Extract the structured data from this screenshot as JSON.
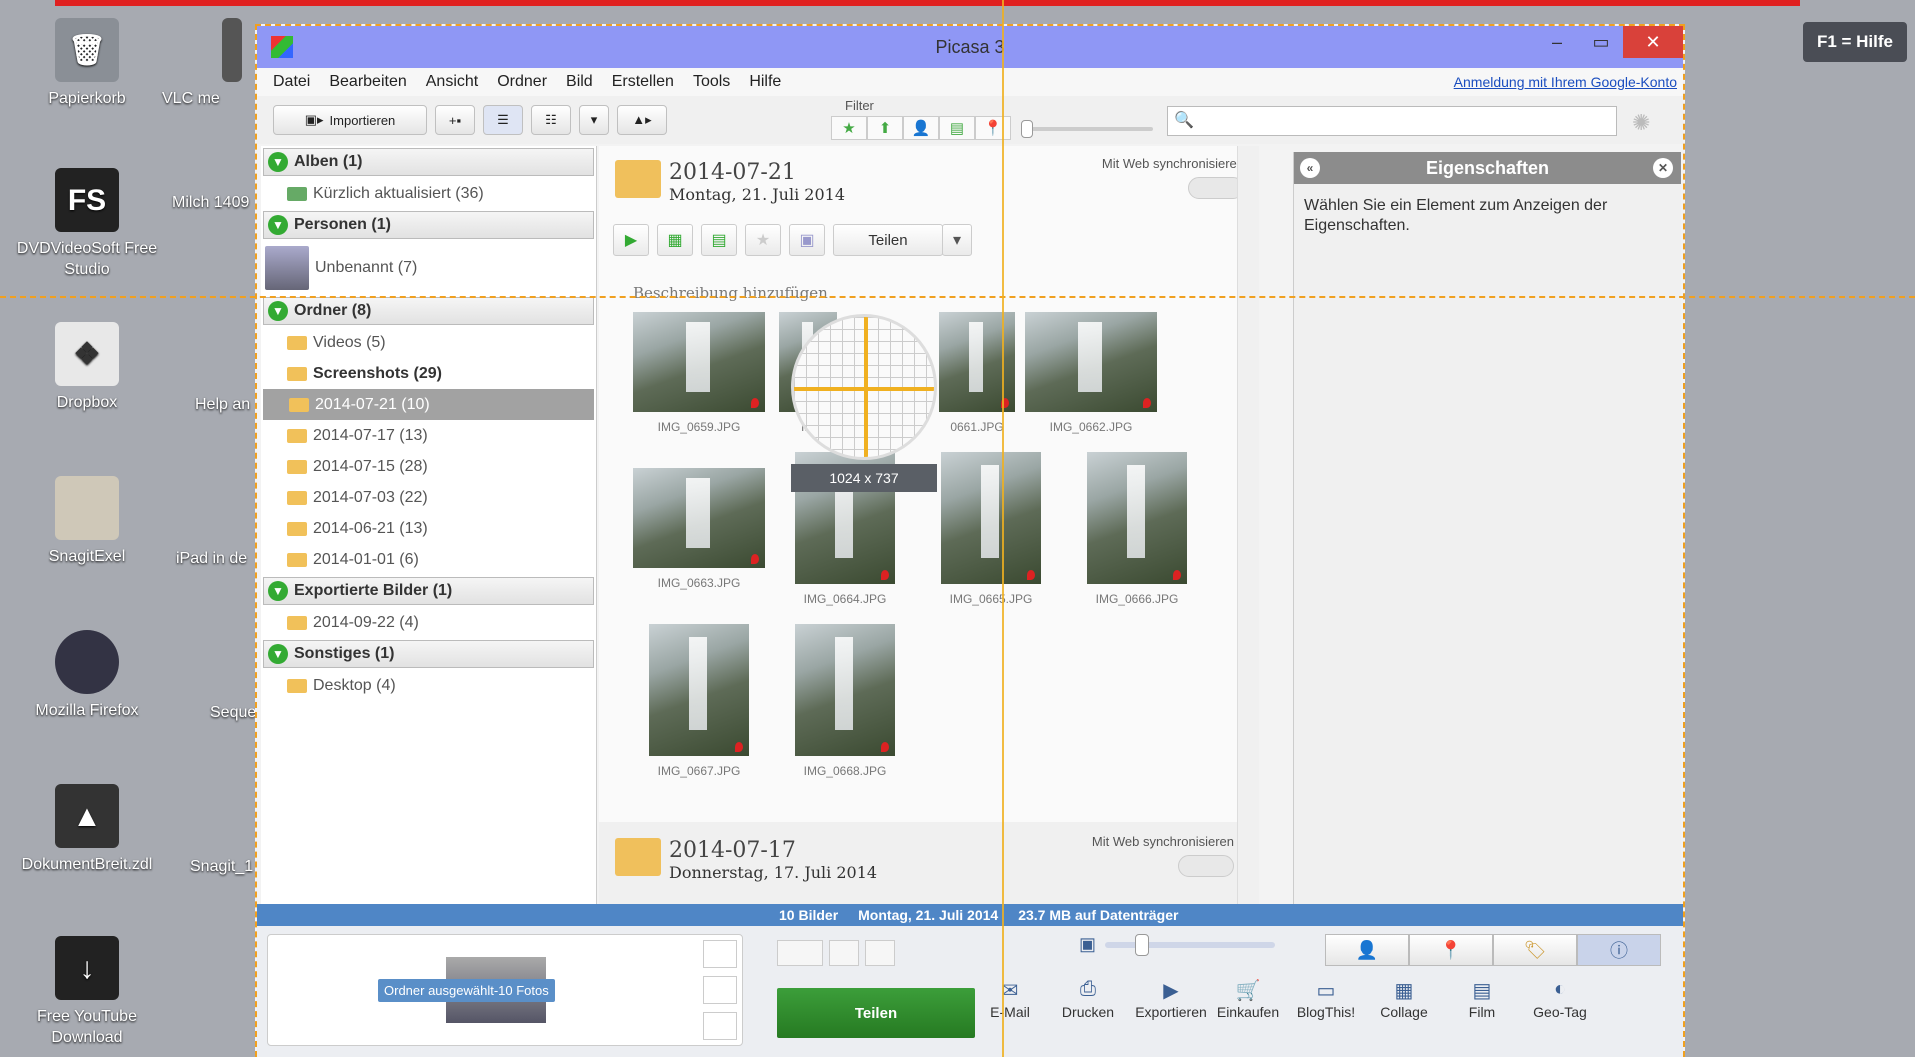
{
  "help": "F1 = Hilfe",
  "desktop": [
    {
      "label": "Papierkorb"
    },
    {
      "label": "VLC me"
    },
    {
      "label": "DVDVideoSoft Free Studio"
    },
    {
      "label": "Milch 1409"
    },
    {
      "label": "Dropbox"
    },
    {
      "label": "Help an"
    },
    {
      "label": "SnagitExel"
    },
    {
      "label": "iPad in de"
    },
    {
      "label": "Mozilla Firefox"
    },
    {
      "label": "Seque"
    },
    {
      "label": "DokumentBreit.zdl"
    },
    {
      "label": "Snagit_1"
    },
    {
      "label": "Free YouTube Download"
    }
  ],
  "window": {
    "title": "Picasa 3"
  },
  "menu": {
    "items": [
      "Datei",
      "Bearbeiten",
      "Ansicht",
      "Ordner",
      "Bild",
      "Erstellen",
      "Tools",
      "Hilfe"
    ],
    "login": "Anmeldung mit Ihrem Google-Konto"
  },
  "toolbar": {
    "import": "Importieren",
    "filter": "Filter"
  },
  "sidebar": {
    "albums": "Alben (1)",
    "recent": "Kürzlich aktualisiert (36)",
    "people": "Personen (1)",
    "unnamed": "Unbenannt (7)",
    "folders": "Ordner (8)",
    "folder_items": [
      "Videos (5)",
      "Screenshots (29)",
      "2014-07-21 (10)",
      "2014-07-17 (13)",
      "2014-07-15 (28)",
      "2014-07-03 (22)",
      "2014-06-21 (13)",
      "2014-01-01 (6)"
    ],
    "exported": "Exportierte Bilder (1)",
    "exported_item": "2014-09-22 (4)",
    "other": "Sonstiges (1)",
    "other_item": "Desktop (4)"
  },
  "main": {
    "folder1": {
      "date": "2014-07-21",
      "sub": "Montag, 21. Juli 2014"
    },
    "folder2": {
      "date": "2014-07-17",
      "sub": "Donnerstag, 17. Juli 2014"
    },
    "sync": "Mit Web synchronisieren",
    "share": "Teilen",
    "description": "Beschreibung hinzufügen",
    "thumbs": [
      "IMG_0659.JPG",
      "IMG_",
      "0661.JPG",
      "IMG_0662.JPG",
      "IMG_0663.JPG",
      "IMG_0664.JPG",
      "IMG_0665.JPG",
      "IMG_0666.JPG",
      "IMG_0667.JPG",
      "IMG_0668.JPG"
    ],
    "dimensions": "1024 x 737"
  },
  "properties": {
    "title": "Eigenschaften",
    "text": "Wählen Sie ein Element zum Anzeigen der Eigenschaften."
  },
  "status": {
    "count": "10 Bilder",
    "date": "Montag, 21. Juli 2014",
    "size": "23.7 MB auf Datenträger"
  },
  "tray": {
    "label": "Ordner ausgewählt-10 Fotos"
  },
  "bottom": {
    "share": "Teilen",
    "actions": [
      "E-Mail",
      "Drucken",
      "Exportieren",
      "Einkaufen",
      "BlogThis!",
      "Collage",
      "Film",
      "Geo-Tag"
    ]
  }
}
